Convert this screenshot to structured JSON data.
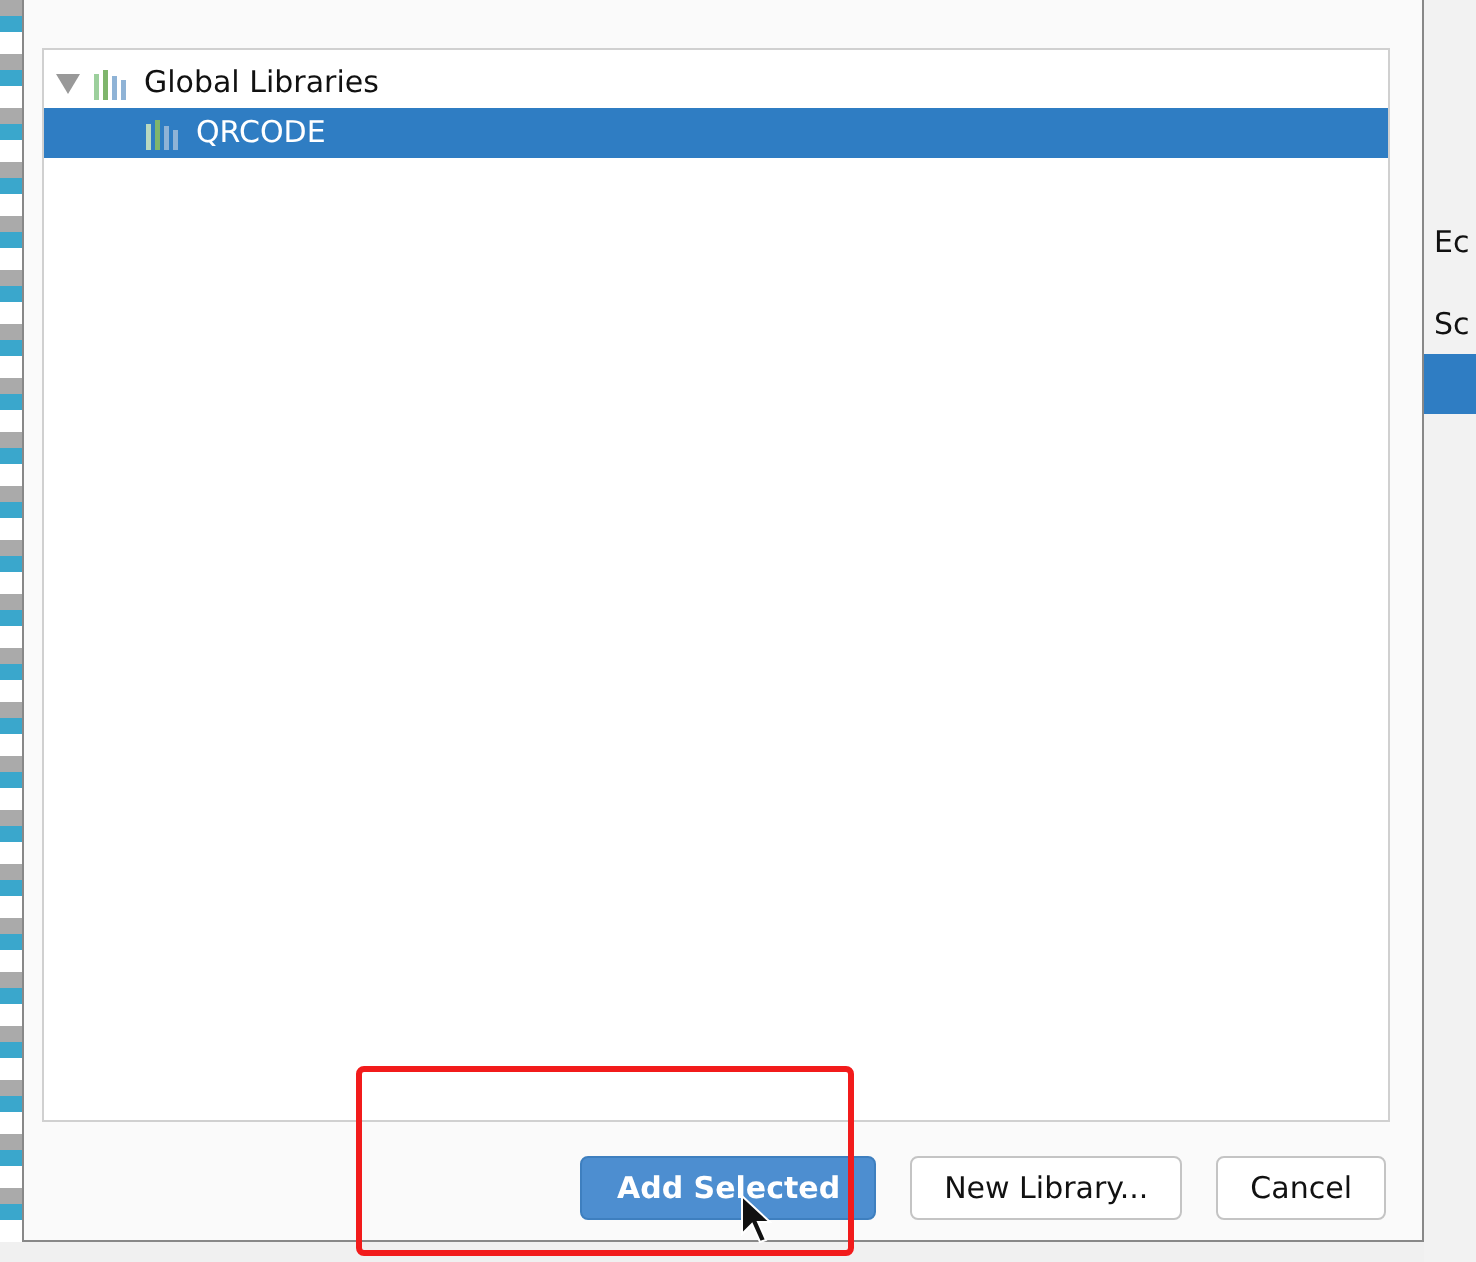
{
  "tree": [
    {
      "label": "Global Libraries",
      "expanded": true,
      "selected": false,
      "children": [
        {
          "label": "QRCODE",
          "selected": true
        }
      ]
    }
  ],
  "buttons": [
    {
      "label": "Add Selected",
      "kind": "primary"
    },
    {
      "label": "New Library...",
      "kind": "default"
    },
    {
      "label": "Cancel",
      "kind": "default"
    }
  ],
  "background_window": {
    "texts": [
      "Ec",
      "Sc"
    ]
  },
  "annotations": [
    {
      "kind": "rectangle"
    }
  ]
}
